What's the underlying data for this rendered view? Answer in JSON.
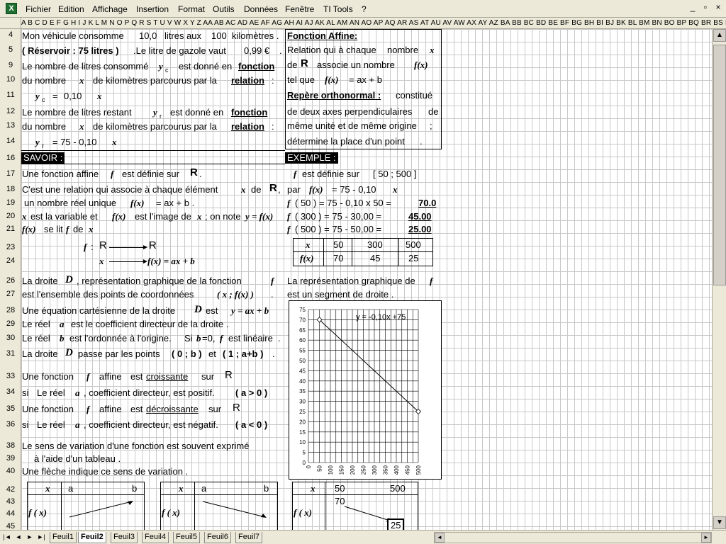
{
  "menu": {
    "app_icon": "X",
    "items": [
      "Fichier",
      "Edition",
      "Affichage",
      "Insertion",
      "Format",
      "Outils",
      "Données",
      "Fenêtre",
      "TI Tools",
      "?"
    ],
    "window_controls": [
      "_",
      "▫",
      "×"
    ]
  },
  "col_header": "A B C D E F G H I J K L M N O P Q R S T U V W X Y Z AA AB AC AD AE AF AG AH AI AJ AK AL AM AN AO AP AQ AR AS AT AU AV AW AX AY AZ BA BB BC BD BE BF BG BH BI BJ BK BL BM BN BO BP BQ BR BS BT BU BV BW BX BY BZ CA CB CC CD CE CF CG CH",
  "rows": [
    "4",
    "5",
    "9",
    "10",
    "11",
    "12",
    "13",
    "14",
    "16",
    "17",
    "18",
    "19",
    "20",
    "21",
    "23",
    "24",
    "26",
    "27",
    "28",
    "29",
    "30",
    "31",
    "33",
    "34",
    "35",
    "36",
    "38",
    "39",
    "40",
    "42",
    "43",
    "44",
    "45"
  ],
  "left": {
    "r4": "Mon véhicule consomme",
    "r4_v1": "10,0",
    "r4_t2": "litres aux",
    "r4_v2": "100",
    "r4_t3": "kilomètres .",
    "r5": "( Réservoir : 75 litres )",
    "r5_b": ".Le litre de gazole vaut",
    "r5_v": "0,99 €",
    "r5_end": ".",
    "r9a": "Le nombre de litres consommé",
    "r9_sym": "y",
    "r9_sub": "c",
    "r9b": "est donné en",
    "r9c": "fonction",
    "r10a": "du nombre",
    "r10_x": "x",
    "r10b": "de kilomètres parcourus par la",
    "r10c": "relation",
    "r10d": ":",
    "r11_sym": "y",
    "r11_sub": "c",
    "r11_eq": "=",
    "r11_v": "0,10",
    "r11_x": "x",
    "r12a": "Le nombre de litres restant",
    "r12_sym": "y",
    "r12_sub": "r",
    "r12b": "est donné en",
    "r12c": "fonction",
    "r13a": "du nombre",
    "r13_x": "x",
    "r13b": "de kilomètres parcourus par la",
    "r13c": "relation",
    "r13d": ":",
    "r14_sym": "y",
    "r14_sub": "r",
    "r14_eq": "= 75  - 0,10",
    "r14_x": "x",
    "savoir": "SAVOIR :",
    "r17a": "Une fonction affine",
    "r17_f": "f",
    "r17b": "est définie sur",
    "r17_R": "R",
    "r17_end": ".",
    "r18a": "C'est une relation qui associe à chaque élément",
    "r18_x": "x",
    "r18b": "de",
    "r18_R": "R",
    "r18_end": ",",
    "r19a": "un nombre réel unique",
    "r19_fx": "f(x)",
    "r19b": "=  ax + b  .",
    "r20_x": "x",
    "r20a": "est la variable et",
    "r20_fx": "f(x)",
    "r20b": "est l'image de",
    "r20_x2": "x",
    "r20c": "; on note",
    "r20_y": "y = f(x)",
    "r21_fx": "f(x)",
    "r21a": "se lit",
    "r21_f": "f",
    "r21b": "de",
    "r21_x": "x",
    "r23_f": "f",
    "r23_colon": ":",
    "r23_R1": "R",
    "r23_R2": "R",
    "r24_x": "x",
    "r24_fx": "f(x) = ax + b",
    "r26a": "La droite",
    "r26_D": "D",
    "r26b": ", représentation graphique de la fonction",
    "r26_f": "f",
    "r27a": "est l'ensemble des points de coordonnées",
    "r27b": "( x ; f(x) )",
    "r27_end": ".",
    "r28a": "Une équation cartésienne de la droite",
    "r28_D": "D",
    "r28b": "est",
    "r28_eq": "y = ax + b",
    "r29a": "Le réel",
    "r29_a": "a",
    "r29b": "est le coefficient directeur de la droite .",
    "r30a": "Le réel",
    "r30_b": "b",
    "r30b": "est l'ordonnée à l'origine.",
    "r30c": "Si",
    "r30_b0": "b",
    "r30d": "=0,",
    "r30_f": "f",
    "r30e": "est linéaire",
    "r30_end": ".",
    "r31a": "La droite",
    "r31_D": "D",
    "r31b": "passe par les points",
    "r31c": "( 0 ; b )",
    "r31d": "et",
    "r31e": "( 1 ; a+b )",
    "r31_end": ".",
    "r33a": "Une fonction",
    "r33_f": "f",
    "r33b": "affine",
    "r33c": "est",
    "r33d": "croissante",
    "r33e": "sur",
    "r33_R": "R",
    "r34a": "si",
    "r34b": "Le réel",
    "r34_a": "a",
    "r34c": ", coefficient directeur, est positif.",
    "r34d": "( a  > 0 )",
    "r35a": "Une fonction",
    "r35_f": "f",
    "r35b": "affine",
    "r35c": "est",
    "r35d": "décroissante",
    "r35e": "sur",
    "r35_R": "R",
    "r36a": "si",
    "r36b": "Le réel",
    "r36_a": "a",
    "r36c": ", coefficient directeur, est négatif.",
    "r36d": "( a  < 0 )",
    "r38": "Le sens de variation d'une fonction est  souvent exprimé",
    "r39": "à l'aide d'un tableau .",
    "r40": "Une flèche indique ce sens de variation .",
    "t1_x": "x",
    "t1_a": "a",
    "t1_b": "b",
    "t1_f": "f ( x)",
    "t2_x": "x",
    "t2_a": "a",
    "t2_b": "b",
    "t2_f": "f ( x)"
  },
  "right": {
    "fa_title": "Fonction Affine:",
    "r5a": "Relation qui à chaque",
    "r5b": "nombre",
    "r5_x": "x",
    "r9a": "de",
    "r9_R": "R",
    "r9b": "associe un nombre",
    "r9_fx": "f(x)",
    "r10a": "tel que",
    "r10_fx": "f(x)",
    "r10b": "= ax + b",
    "r11a": "Repère orthonormal :",
    "r11b": "constitué",
    "r12": "de deux axes perpendiculaires",
    "r12_de": "de",
    "r13": "même unité et de même origine",
    "r13_end": ";",
    "r14": "détermine la place d'un point",
    "r14_end": ".",
    "exemple": "EXEMPLE :",
    "r17_f": "f",
    "r17a": "est définie sur",
    "r17b": "[  50  ;   500  ]",
    "r18a": "par",
    "r18_fx": "f(x)",
    "r18b": "=  75    - 0,10",
    "r18_x": "x",
    "r19_f": "f",
    "r19a": "(  50  )  = 75    - 0,10    x  50 =",
    "r19v": "70.0",
    "r20_f": "f",
    "r20a": "(  300  ) = 75  - 30,00  =",
    "r20v": "45.00",
    "r21_f": "f",
    "r21a": "(  500  ) = 75  - 50,00  =",
    "r21v": "25.00",
    "tab_x": "x",
    "tab_fx": "f(x)",
    "tab_xs": [
      "50",
      "300",
      "500"
    ],
    "tab_ys": [
      "70",
      "45",
      "25"
    ],
    "r26a": "La représentation graphique de",
    "r26_f": "f",
    "r27": "est un segment de droite .",
    "t3_x": "x",
    "t3_a": "50",
    "t3_b": "500",
    "t3_f": "f ( x)",
    "t3_v1": "70",
    "t3_v2": "25"
  },
  "chart_data": {
    "type": "line",
    "x": [
      50,
      500
    ],
    "y": [
      70,
      25
    ],
    "annotation": "y = -0,10x  +75",
    "xlim": [
      0,
      500
    ],
    "ylim": [
      0,
      75
    ],
    "x_ticks": [
      "0",
      "50",
      "100",
      "150",
      "200",
      "250",
      "300",
      "350",
      "400",
      "450",
      "500"
    ],
    "y_ticks": [
      "0",
      "5",
      "10",
      "15",
      "20",
      "25",
      "30",
      "35",
      "40",
      "45",
      "50",
      "55",
      "60",
      "65",
      "70",
      "75"
    ],
    "grid": true
  },
  "tabs": {
    "nav": [
      "|◄",
      "◄",
      "►",
      "►|"
    ],
    "sheets": [
      "Feuil1",
      "Feuil2",
      "Feuil3",
      "Feuil4",
      "Feuil5",
      "Feuil6",
      "Feuil7"
    ],
    "active": "Feuil2"
  },
  "colors": {
    "chrome": "#ece9d8",
    "gridline": "#c8c8c8",
    "header_band": "#000000"
  }
}
